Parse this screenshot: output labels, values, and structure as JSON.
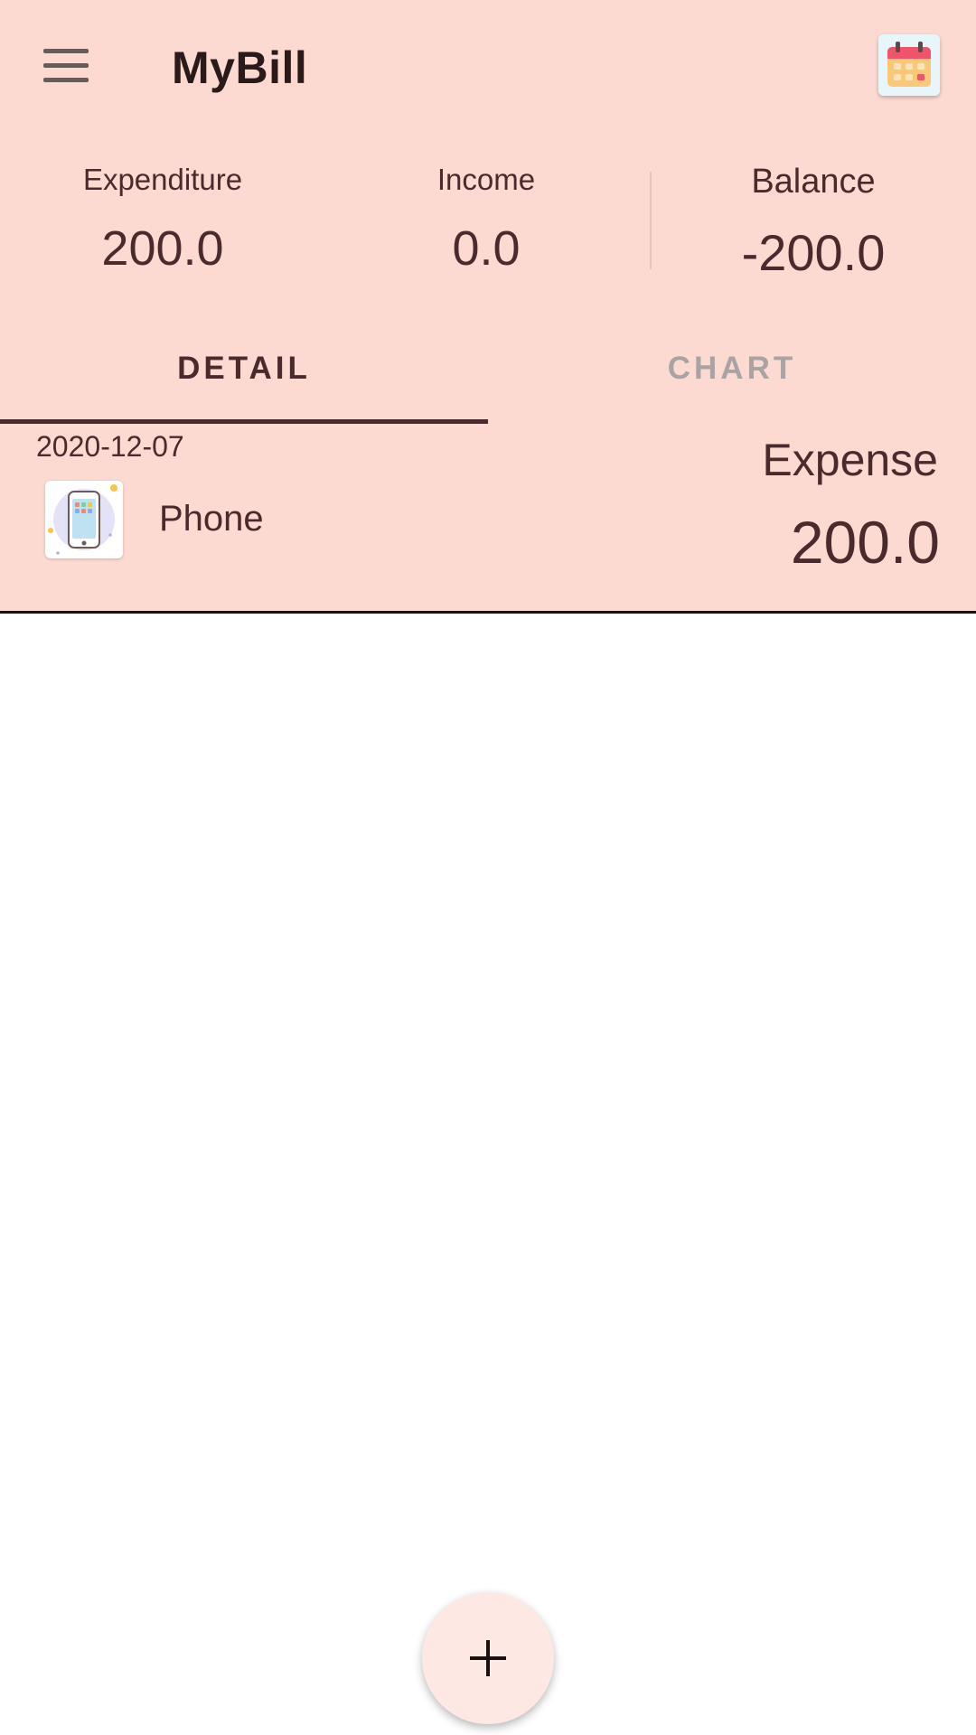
{
  "app_bar": {
    "title": "MyBill",
    "menu_icon": "hamburger-menu-icon",
    "calendar_icon": "calendar-icon"
  },
  "summary": {
    "expenditure": {
      "label": "Expenditure",
      "value": "200.0"
    },
    "income": {
      "label": "Income",
      "value": "0.0"
    },
    "balance": {
      "label": "Balance",
      "value": "-200.0"
    }
  },
  "tabs": [
    {
      "label": "DETAIL",
      "selected": true
    },
    {
      "label": "CHART",
      "selected": false
    }
  ],
  "bills": [
    {
      "date": "2020-12-07",
      "type": "Expense",
      "category": "Phone",
      "category_icon": "phone-icon",
      "amount": "200.0"
    }
  ],
  "fab": {
    "icon": "plus-icon"
  },
  "colors": {
    "header_bg": "#fcdad2",
    "text": "#4a2a2c",
    "tab_inactive": "#a9a3a3",
    "fab_bg": "#fde8e4"
  }
}
